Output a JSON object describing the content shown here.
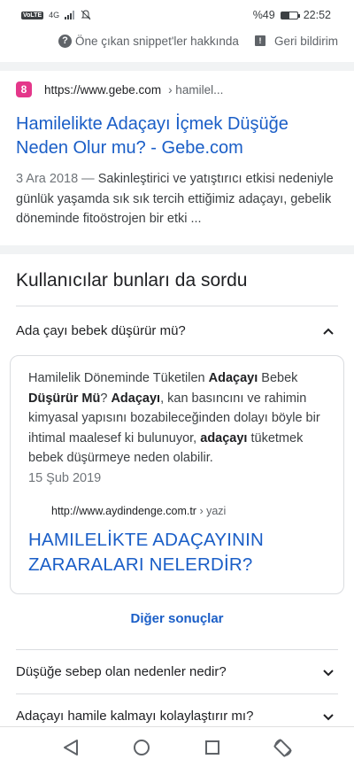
{
  "status": {
    "network": "4G",
    "volte": "VoLTE",
    "battery": "%49",
    "battery_level": 0.49,
    "time": "22:52"
  },
  "snippet_bar": {
    "about_label": "Öne çıkan snippet'ler hakkında",
    "feedback_label": "Geri bildirim"
  },
  "result": {
    "favicon_letter": "8",
    "url": "https://www.gebe.com",
    "breadcrumb": "› hamilel...",
    "title": "Hamilelikte Adaçayı İçmek Düşüğe Neden Olur mu? - Gebe.com",
    "date": "3 Ara 2018",
    "dash": " — ",
    "snippet": "Sakinleştirici ve yatıştırıcı etkisi nedeniyle günlük yaşamda sık sık tercih ettiğimiz adaçayı, gebelik döneminde fitoöstrojen bir etki ..."
  },
  "paa": {
    "title": "Kullanıcılar bunları da sordu",
    "open_question": "Ada çayı bebek düşürür mü?",
    "answer": {
      "t1": "Hamilelik Döneminde Tüketilen ",
      "b1": "Adaçayı",
      "t2": " Bebek ",
      "b2": "Düşürür Mü",
      "t3": "? ",
      "b3": "Adaçayı",
      "t4": ", kan basıncını ve rahimin kimyasal yapısını bozabileceğinden dolayı böyle bir ihtimal maalesef ki bulunuyor, ",
      "b4": "adaçayı",
      "t5": " tüketmek bebek düşürmeye neden olabilir.",
      "date": "15 Şub 2019",
      "source_url": "http://www.aydindenge.com.tr",
      "source_crumb": "› yazi",
      "link_title": "HAMILELİKTE ADAÇAYININ ZARARALARI NELERDİR?"
    },
    "more_label": "Diğer sonuçlar",
    "questions": [
      "Düşüğe sebep olan nedenler nedir?",
      "Adaçayı hamile kalmayı kolaylaştırır mı?"
    ]
  },
  "colors": {
    "link": "#1a5ec7",
    "favicon": "#e4378a",
    "divider": "#dadce0"
  }
}
